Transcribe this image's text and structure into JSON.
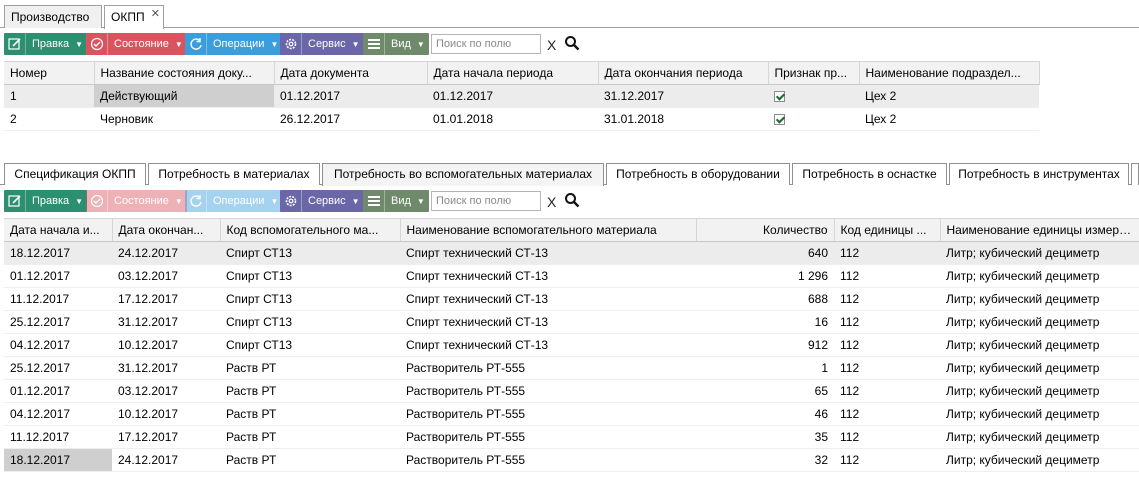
{
  "top_tabs": [
    {
      "label": "Производство"
    },
    {
      "label": "ОКПП"
    }
  ],
  "toolbar1": {
    "edit": "Правка",
    "state": "Состояние",
    "operations": "Операции",
    "service": "Сервис",
    "view": "Вид",
    "search_placeholder": "Поиск по полю",
    "clear": "X"
  },
  "grid1": {
    "columns": [
      "Номер",
      "Название состояния доку...",
      "Дата документа",
      "Дата начала периода",
      "Дата окончания периода",
      "Признак пр...",
      "Наименование подраздел..."
    ],
    "rows": [
      {
        "num": "1",
        "state": "Действующий",
        "doc_date": "01.12.2017",
        "start": "01.12.2017",
        "end": "31.12.2017",
        "flag": true,
        "dept": "Цех 2"
      },
      {
        "num": "2",
        "state": "Черновик",
        "doc_date": "26.12.2017",
        "start": "01.01.2018",
        "end": "31.01.2018",
        "flag": true,
        "dept": "Цех 2"
      }
    ]
  },
  "sub_tabs": [
    {
      "label": "Спецификация ОКПП"
    },
    {
      "label": "Потребность в материалах"
    },
    {
      "label": "Потребность во вспомогательных материалах"
    },
    {
      "label": "Потребность в оборудовании"
    },
    {
      "label": "Потребность в оснастке"
    },
    {
      "label": "Потребность в инструментах"
    }
  ],
  "toolbar2": {
    "edit": "Правка",
    "state": "Состояние",
    "operations": "Операции",
    "service": "Сервис",
    "view": "Вид",
    "search_placeholder": "Поиск по полю",
    "clear": "X"
  },
  "grid2": {
    "columns": [
      "Дата начала и...",
      "Дата окончан...",
      "Код вспомогательного ма...",
      "Наименование вспомогательного материала",
      "Количество",
      "Код единицы ...",
      "Наименование единицы измерени"
    ],
    "rows": [
      {
        "start": "18.12.2017",
        "end": "24.12.2017",
        "code": "Спирт СТ13",
        "name": "Спирт технический СТ-13",
        "qty": "640",
        "unit_code": "112",
        "unit_name": "Литр; кубический дециметр"
      },
      {
        "start": "01.12.2017",
        "end": "03.12.2017",
        "code": "Спирт СТ13",
        "name": "Спирт технический СТ-13",
        "qty": "1 296",
        "unit_code": "112",
        "unit_name": "Литр; кубический дециметр"
      },
      {
        "start": "11.12.2017",
        "end": "17.12.2017",
        "code": "Спирт СТ13",
        "name": "Спирт технический СТ-13",
        "qty": "688",
        "unit_code": "112",
        "unit_name": "Литр; кубический дециметр"
      },
      {
        "start": "25.12.2017",
        "end": "31.12.2017",
        "code": "Спирт СТ13",
        "name": "Спирт технический СТ-13",
        "qty": "16",
        "unit_code": "112",
        "unit_name": "Литр; кубический дециметр"
      },
      {
        "start": "04.12.2017",
        "end": "10.12.2017",
        "code": "Спирт СТ13",
        "name": "Спирт технический СТ-13",
        "qty": "912",
        "unit_code": "112",
        "unit_name": "Литр; кубический дециметр"
      },
      {
        "start": "25.12.2017",
        "end": "31.12.2017",
        "code": "Раств РТ",
        "name": "Растворитель РТ-555",
        "qty": "1",
        "unit_code": "112",
        "unit_name": "Литр; кубический дециметр"
      },
      {
        "start": "01.12.2017",
        "end": "03.12.2017",
        "code": "Раств РТ",
        "name": "Растворитель РТ-555",
        "qty": "65",
        "unit_code": "112",
        "unit_name": "Литр; кубический дециметр"
      },
      {
        "start": "04.12.2017",
        "end": "10.12.2017",
        "code": "Раств РТ",
        "name": "Растворитель РТ-555",
        "qty": "46",
        "unit_code": "112",
        "unit_name": "Литр; кубический дециметр"
      },
      {
        "start": "11.12.2017",
        "end": "17.12.2017",
        "code": "Раств РТ",
        "name": "Растворитель РТ-555",
        "qty": "35",
        "unit_code": "112",
        "unit_name": "Литр; кубический дециметр"
      },
      {
        "start": "18.12.2017",
        "end": "24.12.2017",
        "code": "Раств РТ",
        "name": "Растворитель РТ-555",
        "qty": "32",
        "unit_code": "112",
        "unit_name": "Литр; кубический дециметр"
      }
    ]
  },
  "colors": {
    "green": "#2c8f6f",
    "red": "#d9545f",
    "blue": "#3a9ddc",
    "purple": "#6b66a8",
    "olive": "#6f8a6a"
  },
  "icons": [
    "edit-icon",
    "state-icon",
    "refresh-icon",
    "gear-icon",
    "view-icon",
    "search-icon",
    "close-icon"
  ]
}
